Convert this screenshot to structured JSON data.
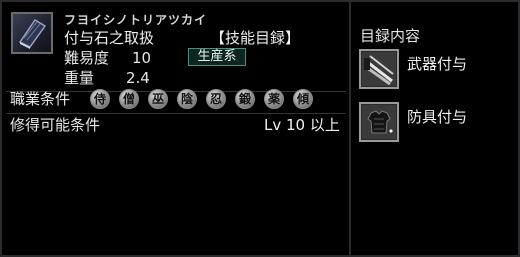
{
  "item": {
    "reading": "フヨイシノトリアツカイ",
    "name": "付与石之取扱",
    "type": "【技能目録】",
    "difficulty_label": "難易度",
    "difficulty_value": "10",
    "category": "生産系",
    "weight_label": "重量",
    "weight_value": "2.4",
    "icon": "book-icon"
  },
  "jobs": {
    "label": "職業条件",
    "list": [
      "侍",
      "僧",
      "巫",
      "陰",
      "忍",
      "鍛",
      "薬",
      "傾"
    ]
  },
  "requirement": {
    "label": "修得可能条件",
    "value": "Lv 10 以上"
  },
  "contents": {
    "title": "目録内容",
    "entries": [
      {
        "label": "武器付与",
        "icon": "weapons-icon"
      },
      {
        "label": "防具付与",
        "icon": "armor-icon"
      }
    ]
  },
  "colors": {
    "background": "#000000",
    "border": "#2b2b2e",
    "badge_border": "#4a8f84",
    "text": "#f0f0f0"
  }
}
